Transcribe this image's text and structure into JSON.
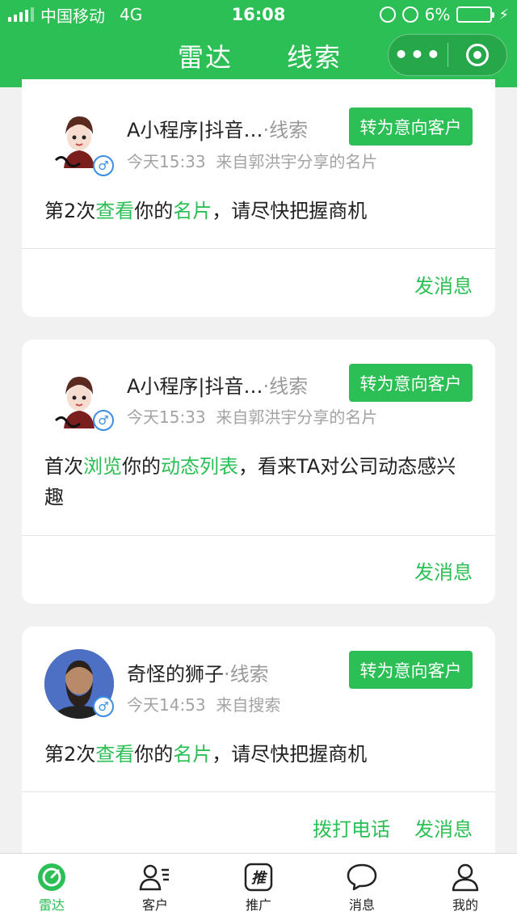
{
  "status_bar": {
    "carrier": "中国移动",
    "network": "4G",
    "time": "16:08",
    "battery": "6%"
  },
  "nav": {
    "tabs": [
      "雷达",
      "线索"
    ]
  },
  "cards": [
    {
      "name": "A小程序|抖音…",
      "tag": "·线索",
      "time": "今天15:33",
      "source": "来自郭洪宇分享的名片",
      "intent_button": "转为意向客户",
      "desc_parts": [
        "第2次",
        "查看",
        "你的",
        "名片",
        "，请尽快把握商机"
      ],
      "action_message": "发消息"
    },
    {
      "name": "A小程序|抖音…",
      "tag": "·线索",
      "time": "今天15:33",
      "source": "来自郭洪宇分享的名片",
      "intent_button": "转为意向客户",
      "desc_parts": [
        "首次",
        "浏览",
        "你的",
        "动态列表",
        "，看来TA对公司动态感兴趣"
      ],
      "action_message": "发消息"
    },
    {
      "name": "奇怪的狮子",
      "tag": "·线索",
      "time": "今天14:53",
      "source": "来自搜索",
      "intent_button": "转为意向客户",
      "desc_parts": [
        "第2次",
        "查看",
        "你的",
        "名片",
        "，请尽快把握商机"
      ],
      "action_call": "拨打电话",
      "action_message": "发消息"
    }
  ],
  "tabbar": {
    "items": [
      {
        "label": "雷达",
        "icon": "radar-icon"
      },
      {
        "label": "客户",
        "icon": "customer-icon"
      },
      {
        "label": "推广",
        "icon": "promote-icon"
      },
      {
        "label": "消息",
        "icon": "message-icon"
      },
      {
        "label": "我的",
        "icon": "profile-icon"
      }
    ]
  },
  "colors": {
    "brand": "#2bbf55",
    "tag_gray": "#999999",
    "gender_blue": "#3a8ee6"
  }
}
